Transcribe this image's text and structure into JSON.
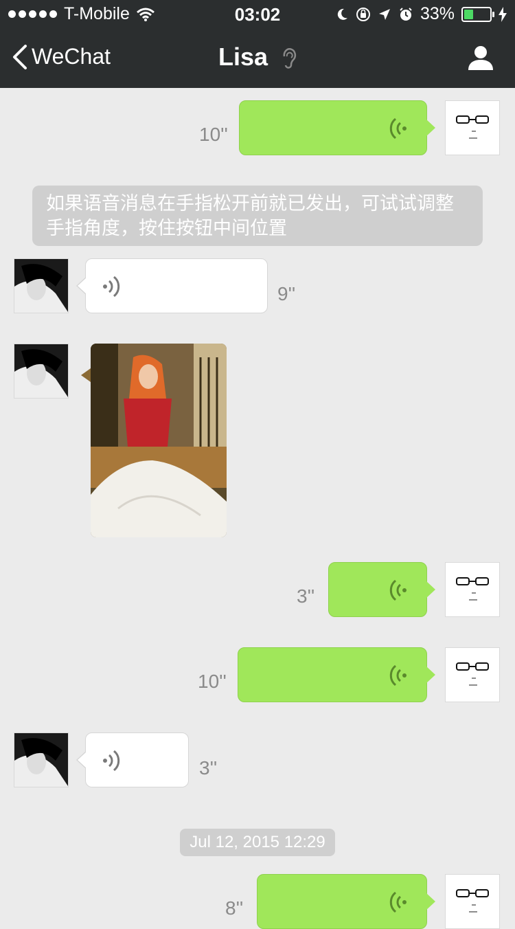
{
  "status_bar": {
    "carrier": "T-Mobile",
    "time": "03:02",
    "battery": "33%"
  },
  "nav": {
    "back_label": "WeChat",
    "title": "Lisa"
  },
  "messages": [
    {
      "from": "me",
      "type": "voice",
      "duration": "10''"
    },
    {
      "type": "system",
      "text": "如果语音消息在手指松开前就已发出，可试试调整手指角度，按住按钮中间位置"
    },
    {
      "from": "lisa",
      "type": "voice",
      "duration": "9''"
    },
    {
      "from": "lisa",
      "type": "image"
    },
    {
      "from": "me",
      "type": "voice",
      "duration": "3''"
    },
    {
      "from": "me",
      "type": "voice",
      "duration": "10''"
    },
    {
      "from": "lisa",
      "type": "voice",
      "duration": "3''"
    },
    {
      "type": "timestamp",
      "text": "Jul 12, 2015 12:29"
    },
    {
      "from": "me",
      "type": "voice",
      "duration": "8''"
    }
  ],
  "colors": {
    "header_bg": "#2b2e2f",
    "chat_bg": "#ebebeb",
    "my_bubble": "#a0e75a",
    "their_bubble": "#ffffff",
    "voice_icon_green": "#5a8a2c",
    "voice_icon_gray": "#7a7a7a"
  },
  "icons": {
    "back": "chevron-left-icon",
    "ear": "ear-icon",
    "profile": "person-icon",
    "voice": "voice-wave-icon",
    "wifi": "wifi-icon",
    "moon": "moon-icon",
    "location": "location-arrow-icon",
    "alarm": "alarm-icon"
  }
}
